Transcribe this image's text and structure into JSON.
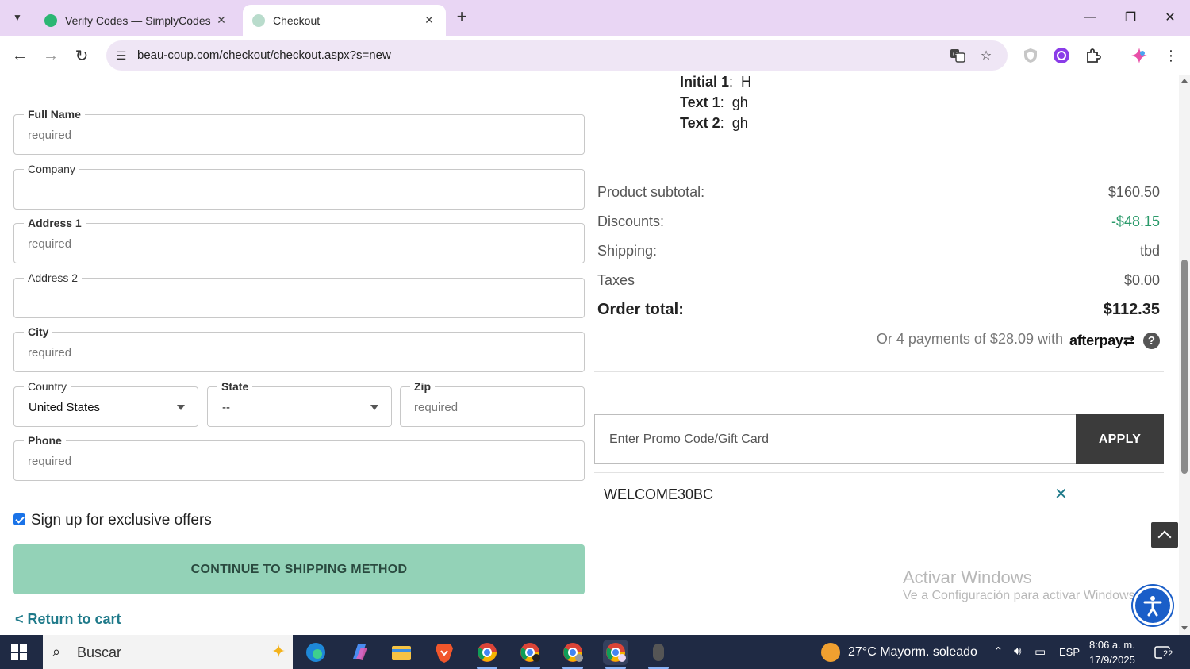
{
  "browser": {
    "tabs": [
      {
        "title": "Verify Codes — SimplyCodes",
        "active": false
      },
      {
        "title": "Checkout",
        "active": true
      }
    ],
    "url": "beau-coup.com/checkout/checkout.aspx?s=new"
  },
  "form": {
    "full_name": {
      "label": "Full Name",
      "placeholder": "required"
    },
    "company": {
      "label": "Company",
      "placeholder": ""
    },
    "address1": {
      "label": "Address 1",
      "placeholder": "required"
    },
    "address2": {
      "label": "Address 2",
      "placeholder": ""
    },
    "city": {
      "label": "City",
      "placeholder": "required"
    },
    "country": {
      "label": "Country",
      "value": "United States"
    },
    "state": {
      "label": "State",
      "value": "--"
    },
    "zip": {
      "label": "Zip",
      "placeholder": "required"
    },
    "phone": {
      "label": "Phone",
      "placeholder": "required"
    },
    "offers_label": "Sign up for exclusive offers",
    "offers_checked": true,
    "continue_label": "CONTINUE TO SHIPPING METHOD",
    "return_label": "< Return to cart"
  },
  "item_attributes": [
    {
      "name": "Initial 1",
      "value": "H"
    },
    {
      "name": "Text 1",
      "value": "gh"
    },
    {
      "name": "Text 2",
      "value": "gh"
    }
  ],
  "summary": {
    "subtotal_label": "Product subtotal:",
    "subtotal_value": "$160.50",
    "discounts_label": "Discounts:",
    "discounts_value": "-$48.15",
    "shipping_label": "Shipping:",
    "shipping_value": "tbd",
    "taxes_label": "Taxes",
    "taxes_value": "$0.00",
    "total_label": "Order total:",
    "total_value": "$112.35",
    "afterpay_text": "Or 4 payments of $28.09 with",
    "afterpay_brand": "afterpay"
  },
  "promo": {
    "placeholder": "Enter Promo Code/Gift Card",
    "apply_label": "APPLY",
    "applied_code": "WELCOME30BC"
  },
  "windows_watermark": {
    "title": "Activar Windows",
    "subtitle": "Ve a Configuración para activar Windows."
  },
  "taskbar": {
    "search_text": "Buscar",
    "weather": "27°C  Mayorm. soleado",
    "language": "ESP",
    "time": "8:06 a. m.",
    "date": "17/9/2025",
    "notifications": "22"
  },
  "colors": {
    "tabbar_bg": "#e9d6f4",
    "continue_btn": "#93d2b7",
    "link": "#1f7a8a",
    "discount": "#2a9a6a"
  }
}
